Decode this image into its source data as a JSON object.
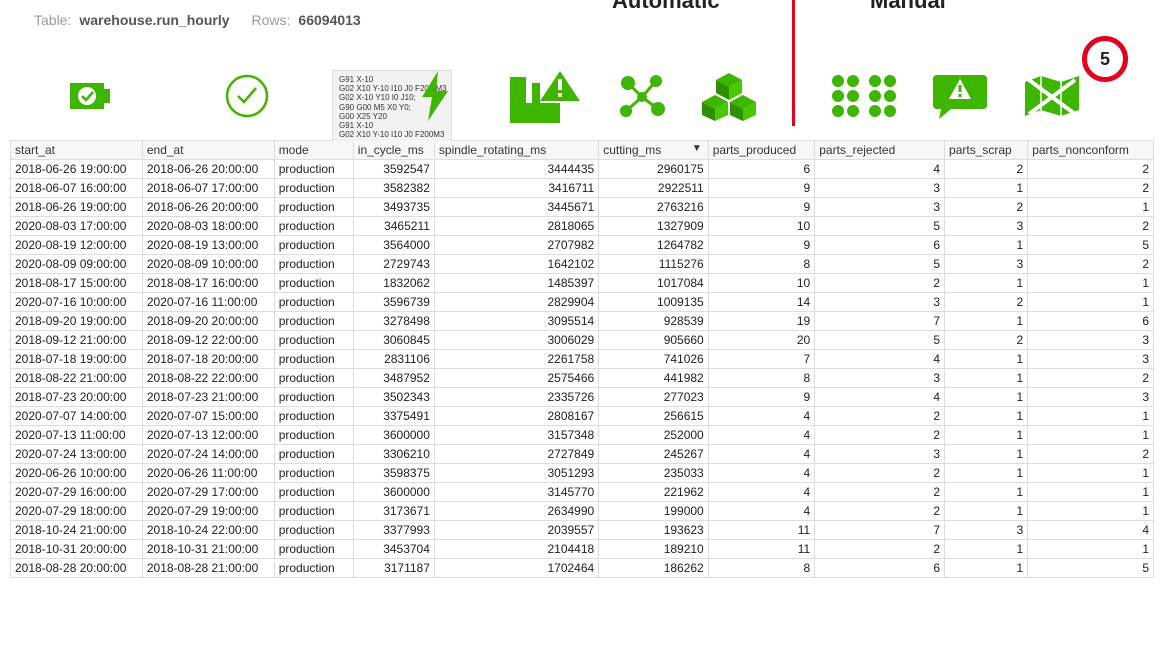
{
  "header": {
    "table_label": "Table:",
    "table_name": "warehouse.run_hourly",
    "rows_label": "Rows:",
    "rows_value": "66094013"
  },
  "alert_badge": "5",
  "groups": {
    "automatic": "Automatic",
    "manual": "Manual"
  },
  "gcode": "G91 X-10\nG02 X10 Y-10 I10 J0 F200 M3\nG02 X-10 Y10 I0 J10;\nG90 G00 M5 X0 Y0;\nG00 X25 Y20\nG91 X-10\nG02 X10 Y-10 I10 J0 F200M3",
  "columns": [
    {
      "key": "start_at",
      "label": "start_at",
      "align": "txt",
      "sorted": false
    },
    {
      "key": "end_at",
      "label": "end_at",
      "align": "txt",
      "sorted": false
    },
    {
      "key": "mode",
      "label": "mode",
      "align": "txt",
      "sorted": false
    },
    {
      "key": "in_cycle_ms",
      "label": "in_cycle_ms",
      "align": "num",
      "sorted": false
    },
    {
      "key": "spindle_rotating_ms",
      "label": "spindle_rotating_ms",
      "align": "num",
      "sorted": false
    },
    {
      "key": "cutting_ms",
      "label": "cutting_ms",
      "align": "num",
      "sorted": true
    },
    {
      "key": "parts_produced",
      "label": "parts_produced",
      "align": "num",
      "sorted": false
    },
    {
      "key": "parts_rejected",
      "label": "parts_rejected",
      "align": "num",
      "sorted": false
    },
    {
      "key": "parts_scrap",
      "label": "parts_scrap",
      "align": "num",
      "sorted": false
    },
    {
      "key": "parts_nonconform",
      "label": "parts_nonconform",
      "align": "num",
      "sorted": false
    }
  ],
  "rows": [
    {
      "start_at": "2018-06-26 19:00:00",
      "end_at": "2018-06-26 20:00:00",
      "mode": "production",
      "in_cycle_ms": 3592547,
      "spindle_rotating_ms": 3444435,
      "cutting_ms": 2960175,
      "parts_produced": 6,
      "parts_rejected": 4,
      "parts_scrap": 2,
      "parts_nonconform": 2
    },
    {
      "start_at": "2018-06-07 16:00:00",
      "end_at": "2018-06-07 17:00:00",
      "mode": "production",
      "in_cycle_ms": 3582382,
      "spindle_rotating_ms": 3416711,
      "cutting_ms": 2922511,
      "parts_produced": 9,
      "parts_rejected": 3,
      "parts_scrap": 1,
      "parts_nonconform": 2
    },
    {
      "start_at": "2018-06-26 19:00:00",
      "end_at": "2018-06-26 20:00:00",
      "mode": "production",
      "in_cycle_ms": 3493735,
      "spindle_rotating_ms": 3445671,
      "cutting_ms": 2763216,
      "parts_produced": 9,
      "parts_rejected": 3,
      "parts_scrap": 2,
      "parts_nonconform": 1
    },
    {
      "start_at": "2020-08-03 17:00:00",
      "end_at": "2020-08-03 18:00:00",
      "mode": "production",
      "in_cycle_ms": 3465211,
      "spindle_rotating_ms": 2818065,
      "cutting_ms": 1327909,
      "parts_produced": 10,
      "parts_rejected": 5,
      "parts_scrap": 3,
      "parts_nonconform": 2
    },
    {
      "start_at": "2020-08-19 12:00:00",
      "end_at": "2020-08-19 13:00:00",
      "mode": "production",
      "in_cycle_ms": 3564000,
      "spindle_rotating_ms": 2707982,
      "cutting_ms": 1264782,
      "parts_produced": 9,
      "parts_rejected": 6,
      "parts_scrap": 1,
      "parts_nonconform": 5
    },
    {
      "start_at": "2020-08-09 09:00:00",
      "end_at": "2020-08-09 10:00:00",
      "mode": "production",
      "in_cycle_ms": 2729743,
      "spindle_rotating_ms": 1642102,
      "cutting_ms": 1115276,
      "parts_produced": 8,
      "parts_rejected": 5,
      "parts_scrap": 3,
      "parts_nonconform": 2
    },
    {
      "start_at": "2018-08-17 15:00:00",
      "end_at": "2018-08-17 16:00:00",
      "mode": "production",
      "in_cycle_ms": 1832062,
      "spindle_rotating_ms": 1485397,
      "cutting_ms": 1017084,
      "parts_produced": 10,
      "parts_rejected": 2,
      "parts_scrap": 1,
      "parts_nonconform": 1
    },
    {
      "start_at": "2020-07-16 10:00:00",
      "end_at": "2020-07-16 11:00:00",
      "mode": "production",
      "in_cycle_ms": 3596739,
      "spindle_rotating_ms": 2829904,
      "cutting_ms": 1009135,
      "parts_produced": 14,
      "parts_rejected": 3,
      "parts_scrap": 2,
      "parts_nonconform": 1
    },
    {
      "start_at": "2018-09-20 19:00:00",
      "end_at": "2018-09-20 20:00:00",
      "mode": "production",
      "in_cycle_ms": 3278498,
      "spindle_rotating_ms": 3095514,
      "cutting_ms": 928539,
      "parts_produced": 19,
      "parts_rejected": 7,
      "parts_scrap": 1,
      "parts_nonconform": 6
    },
    {
      "start_at": "2018-09-12 21:00:00",
      "end_at": "2018-09-12 22:00:00",
      "mode": "production",
      "in_cycle_ms": 3060845,
      "spindle_rotating_ms": 3006029,
      "cutting_ms": 905660,
      "parts_produced": 20,
      "parts_rejected": 5,
      "parts_scrap": 2,
      "parts_nonconform": 3
    },
    {
      "start_at": "2018-07-18 19:00:00",
      "end_at": "2018-07-18 20:00:00",
      "mode": "production",
      "in_cycle_ms": 2831106,
      "spindle_rotating_ms": 2261758,
      "cutting_ms": 741026,
      "parts_produced": 7,
      "parts_rejected": 4,
      "parts_scrap": 1,
      "parts_nonconform": 3
    },
    {
      "start_at": "2018-08-22 21:00:00",
      "end_at": "2018-08-22 22:00:00",
      "mode": "production",
      "in_cycle_ms": 3487952,
      "spindle_rotating_ms": 2575466,
      "cutting_ms": 441982,
      "parts_produced": 8,
      "parts_rejected": 3,
      "parts_scrap": 1,
      "parts_nonconform": 2
    },
    {
      "start_at": "2018-07-23 20:00:00",
      "end_at": "2018-07-23 21:00:00",
      "mode": "production",
      "in_cycle_ms": 3502343,
      "spindle_rotating_ms": 2335726,
      "cutting_ms": 277023,
      "parts_produced": 9,
      "parts_rejected": 4,
      "parts_scrap": 1,
      "parts_nonconform": 3
    },
    {
      "start_at": "2020-07-07 14:00:00",
      "end_at": "2020-07-07 15:00:00",
      "mode": "production",
      "in_cycle_ms": 3375491,
      "spindle_rotating_ms": 2808167,
      "cutting_ms": 256615,
      "parts_produced": 4,
      "parts_rejected": 2,
      "parts_scrap": 1,
      "parts_nonconform": 1
    },
    {
      "start_at": "2020-07-13 11:00:00",
      "end_at": "2020-07-13 12:00:00",
      "mode": "production",
      "in_cycle_ms": 3600000,
      "spindle_rotating_ms": 3157348,
      "cutting_ms": 252000,
      "parts_produced": 4,
      "parts_rejected": 2,
      "parts_scrap": 1,
      "parts_nonconform": 1
    },
    {
      "start_at": "2020-07-24 13:00:00",
      "end_at": "2020-07-24 14:00:00",
      "mode": "production",
      "in_cycle_ms": 3306210,
      "spindle_rotating_ms": 2727849,
      "cutting_ms": 245267,
      "parts_produced": 4,
      "parts_rejected": 3,
      "parts_scrap": 1,
      "parts_nonconform": 2
    },
    {
      "start_at": "2020-06-26 10:00:00",
      "end_at": "2020-06-26 11:00:00",
      "mode": "production",
      "in_cycle_ms": 3598375,
      "spindle_rotating_ms": 3051293,
      "cutting_ms": 235033,
      "parts_produced": 4,
      "parts_rejected": 2,
      "parts_scrap": 1,
      "parts_nonconform": 1
    },
    {
      "start_at": "2020-07-29 16:00:00",
      "end_at": "2020-07-29 17:00:00",
      "mode": "production",
      "in_cycle_ms": 3600000,
      "spindle_rotating_ms": 3145770,
      "cutting_ms": 221962,
      "parts_produced": 4,
      "parts_rejected": 2,
      "parts_scrap": 1,
      "parts_nonconform": 1
    },
    {
      "start_at": "2020-07-29 18:00:00",
      "end_at": "2020-07-29 19:00:00",
      "mode": "production",
      "in_cycle_ms": 3173671,
      "spindle_rotating_ms": 2634990,
      "cutting_ms": 199000,
      "parts_produced": 4,
      "parts_rejected": 2,
      "parts_scrap": 1,
      "parts_nonconform": 1
    },
    {
      "start_at": "2018-10-24 21:00:00",
      "end_at": "2018-10-24 22:00:00",
      "mode": "production",
      "in_cycle_ms": 3377993,
      "spindle_rotating_ms": 2039557,
      "cutting_ms": 193623,
      "parts_produced": 11,
      "parts_rejected": 7,
      "parts_scrap": 3,
      "parts_nonconform": 4
    },
    {
      "start_at": "2018-10-31 20:00:00",
      "end_at": "2018-10-31 21:00:00",
      "mode": "production",
      "in_cycle_ms": 3453704,
      "spindle_rotating_ms": 2104418,
      "cutting_ms": 189210,
      "parts_produced": 11,
      "parts_rejected": 2,
      "parts_scrap": 1,
      "parts_nonconform": 1
    },
    {
      "start_at": "2018-08-28 20:00:00",
      "end_at": "2018-08-28 21:00:00",
      "mode": "production",
      "in_cycle_ms": 3171187,
      "spindle_rotating_ms": 1702464,
      "cutting_ms": 186262,
      "parts_produced": 8,
      "parts_rejected": 6,
      "parts_scrap": 1,
      "parts_nonconform": 5
    }
  ]
}
